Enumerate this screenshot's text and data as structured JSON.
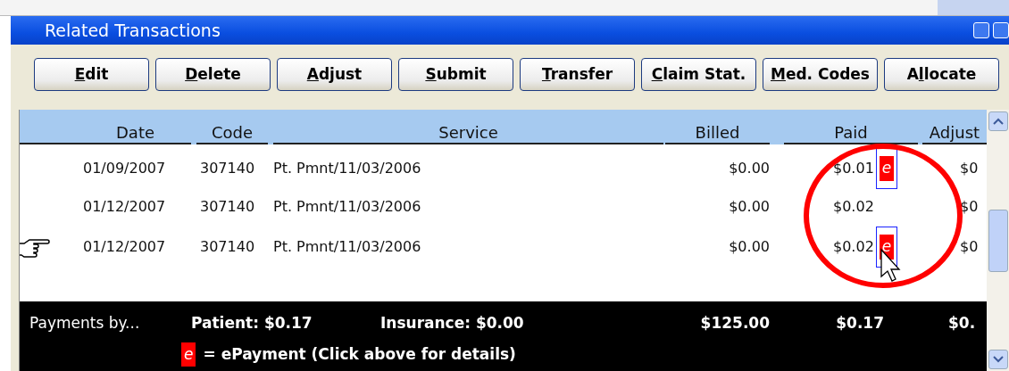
{
  "window": {
    "title": "Related Transactions"
  },
  "toolbar": [
    {
      "key": "E",
      "after": "dit"
    },
    {
      "key": "D",
      "after": "elete"
    },
    {
      "key": "A",
      "after": "djust"
    },
    {
      "key": "S",
      "after": "ubmit"
    },
    {
      "key": "T",
      "after": "ransfer"
    },
    {
      "key": "C",
      "after": "laim Stat."
    },
    {
      "key": "M",
      "after": "ed. Codes"
    },
    {
      "before": "A",
      "key": "l",
      "after": "locate"
    }
  ],
  "table": {
    "columns": [
      "Date",
      "Code",
      "Service",
      "Billed",
      "Paid",
      "Adjust"
    ],
    "rows": [
      {
        "selected": false,
        "date": "01/09/2007",
        "code": "307140",
        "service": "Pt. Pmnt/11/03/2006",
        "billed": "$0.00",
        "paid": "$0.01",
        "epayment": "e",
        "outlined": true,
        "adjust": "$0"
      },
      {
        "selected": false,
        "date": "01/12/2007",
        "code": "307140",
        "service": "Pt. Pmnt/11/03/2006",
        "billed": "$0.00",
        "paid": "$0.02",
        "adjust": "$0"
      },
      {
        "selected": true,
        "date": "01/12/2007",
        "code": "307140",
        "service": "Pt. Pmnt/11/03/2006",
        "billed": "$0.00",
        "paid": "$0.02",
        "epayment": "e",
        "outlined": true,
        "adjust": "$0"
      }
    ]
  },
  "totals": {
    "label": "Payments by...",
    "patient": "Patient: $0.17",
    "insurance": "Insurance: $0.00",
    "billed": "$125.00",
    "paid": "$0.17",
    "adjust": "$0.",
    "legend_badge": "e",
    "legend": "= ePayment (Click above for details)"
  },
  "highlight_circle": true
}
